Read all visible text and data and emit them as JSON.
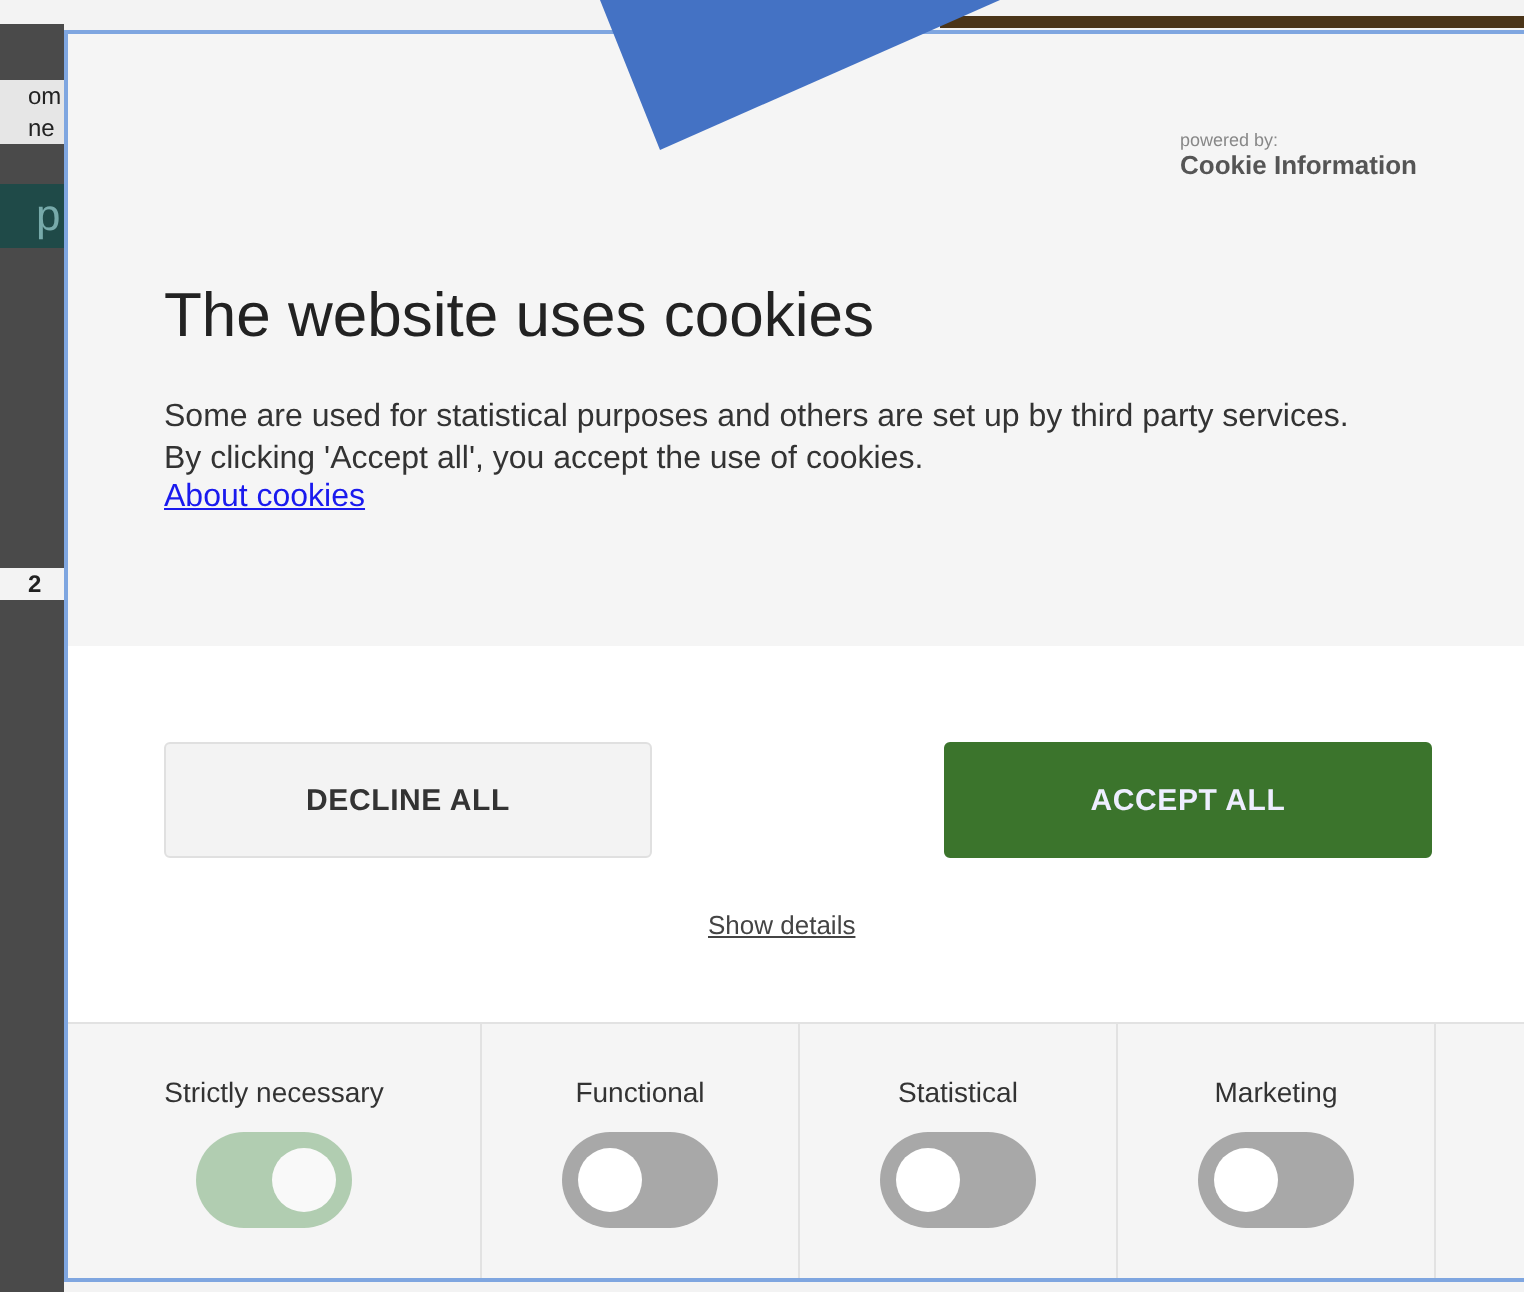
{
  "background_page": {
    "fragments": [
      "om",
      "ne",
      "p",
      "2"
    ]
  },
  "dialog": {
    "powered_by": "powered by:",
    "provider": "Cookie Information",
    "title": "The website uses cookies",
    "text": "Some are used for statistical purposes and others are set up by third party services. By clicking 'Accept all', you accept the use of cookies.",
    "about_link": "About cookies",
    "buttons": [
      {
        "label": "DECLINE ALL",
        "kind": "secondary"
      },
      {
        "label": "ACCEPT ALL",
        "kind": "primary"
      }
    ],
    "details_link": "Show details",
    "categories": [
      {
        "label": "Strictly necessary",
        "on": true,
        "disabled": true
      },
      {
        "label": "Functional",
        "on": false,
        "disabled": false
      },
      {
        "label": "Statistical",
        "on": false,
        "disabled": false
      },
      {
        "label": "Marketing",
        "on": false,
        "disabled": false
      }
    ]
  }
}
